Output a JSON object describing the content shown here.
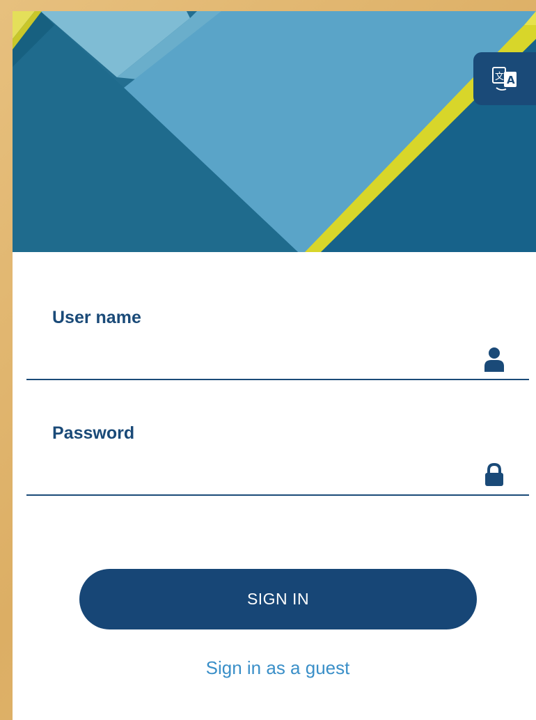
{
  "hero": {
    "translate_button": {
      "icon": "translate-icon"
    }
  },
  "form": {
    "username": {
      "label": "User name",
      "value": "",
      "placeholder": "",
      "icon": "user-icon"
    },
    "password": {
      "label": "Password",
      "value": "",
      "placeholder": "",
      "icon": "lock-icon"
    },
    "sign_in_label": "SIGN IN",
    "guest_link": "Sign in as a guest"
  },
  "colors": {
    "primary": "#174676",
    "link": "#3a8fc8",
    "hero_dark": "#1e6a8c",
    "hero_light": "#5aa4c8",
    "accent_yellow": "#d8d62a"
  }
}
